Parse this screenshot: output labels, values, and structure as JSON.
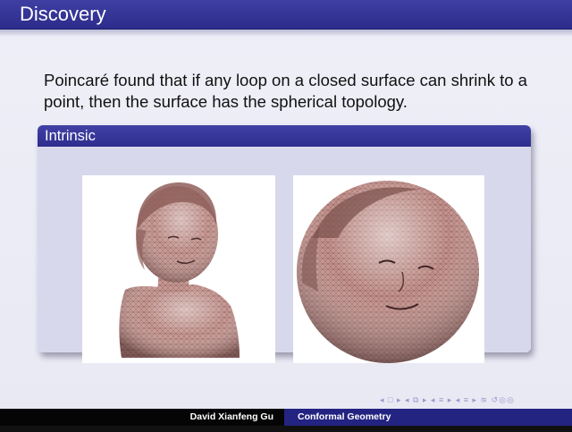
{
  "slide": {
    "title": "Discovery",
    "body_text": "Poincaré found that if any loop on a closed surface can shrink to a point, then the surface has the spherical topology.",
    "block_title": "Intrinsic"
  },
  "images": [
    {
      "name": "bust-mesh",
      "description": "triangulated mesh of a child bust"
    },
    {
      "name": "sphere-mesh",
      "description": "triangulated face mapped onto a sphere"
    }
  ],
  "footer": {
    "author": "David Xianfeng Gu",
    "course": "Conformal Geometry"
  },
  "navigation": {
    "icons": [
      "nav-first-icon",
      "nav-prev-frame-icon",
      "nav-prev-section-icon",
      "nav-next-section-icon",
      "nav-back-icon",
      "nav-search-icon"
    ],
    "glyphs": "◂ □ ▸ ◂ ⧉ ▸ ◂ ≡ ▸ ◂ ≡ ▸ ≊ ↺◎◎"
  },
  "colors": {
    "title_bar": "#2c2c8c",
    "block_header": "#2d2d8f",
    "block_body": "#d8d8ec",
    "slide_bg": "#efeff8",
    "footer_right": "#232381",
    "mesh_skin": "#c99590"
  }
}
